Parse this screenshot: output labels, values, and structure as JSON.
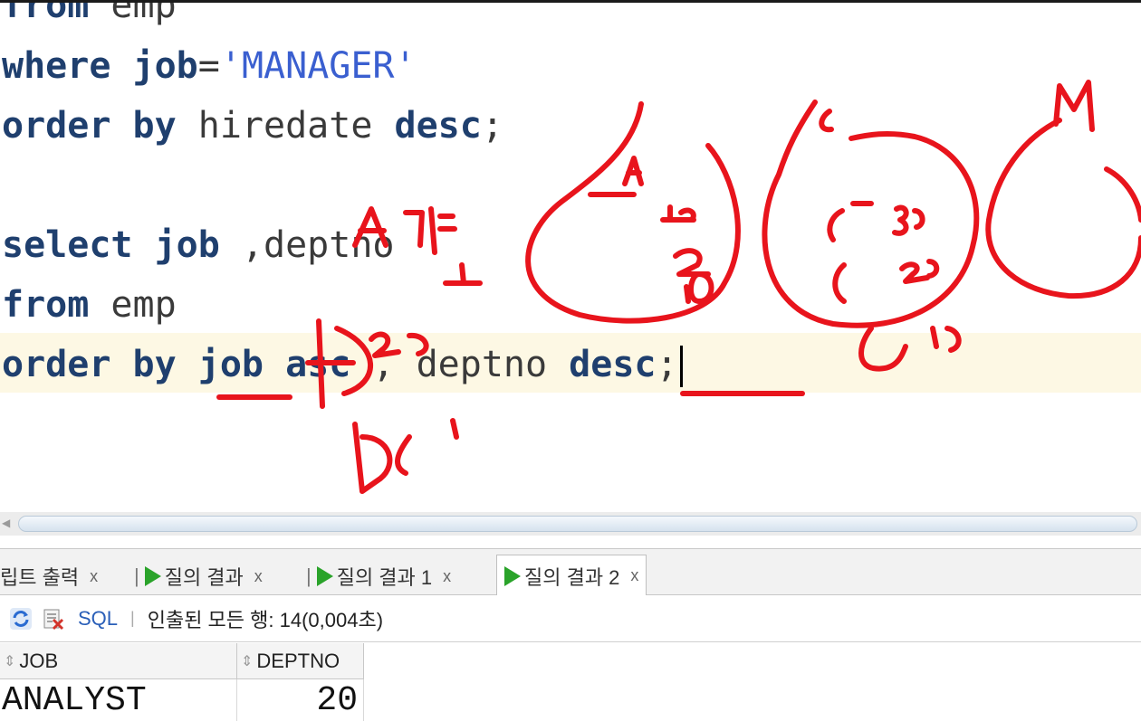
{
  "editor": {
    "lines": [
      {
        "id": "l1",
        "parts": [
          {
            "t": "from",
            "c": "kw"
          },
          {
            "t": " emp"
          }
        ]
      },
      {
        "id": "l2",
        "parts": [
          {
            "t": "where",
            "c": "kw"
          },
          {
            "t": " "
          },
          {
            "t": "job",
            "c": "kw"
          },
          {
            "t": "="
          },
          {
            "t": "'MANAGER'",
            "c": "str"
          }
        ]
      },
      {
        "id": "l3",
        "parts": [
          {
            "t": "order by",
            "c": "kw"
          },
          {
            "t": " hiredate "
          },
          {
            "t": "desc",
            "c": "kw"
          },
          {
            "t": ";"
          }
        ]
      },
      {
        "id": "l4",
        "parts": []
      },
      {
        "id": "l5",
        "parts": [
          {
            "t": "select",
            "c": "kw"
          },
          {
            "t": " "
          },
          {
            "t": "job",
            "c": "kw"
          },
          {
            "t": " ,deptno"
          }
        ]
      },
      {
        "id": "l6",
        "parts": [
          {
            "t": "from",
            "c": "kw"
          },
          {
            "t": " emp"
          }
        ]
      },
      {
        "id": "l7",
        "parts": [
          {
            "t": "order by",
            "c": "kw"
          },
          {
            "t": " "
          },
          {
            "t": "job",
            "c": "kw"
          },
          {
            "t": " "
          },
          {
            "t": "asc",
            "c": "kw"
          },
          {
            "t": " , deptno "
          },
          {
            "t": "desc",
            "c": "kw"
          },
          {
            "t": ";"
          }
        ]
      }
    ]
  },
  "annotations": {
    "ink_color": "#e8141c",
    "labels": [
      "A",
      "C",
      "M",
      "10",
      "20",
      "30",
      "20",
      "10",
      "20",
      "10"
    ]
  },
  "tabs": [
    {
      "label": "립트 출력",
      "close": "x",
      "icon": "none",
      "active": false
    },
    {
      "label": "질의 결과",
      "close": "x",
      "icon": "play",
      "active": false
    },
    {
      "label": "질의 결과 1",
      "close": "x",
      "icon": "play",
      "active": false
    },
    {
      "label": "질의 결과 2",
      "close": "x",
      "icon": "play",
      "active": true
    }
  ],
  "toolbar": {
    "refresh_icon": "refresh-icon",
    "clear_icon": "clear-icon",
    "sql_label": "SQL",
    "divider": "|",
    "status": "인출된 모든 행: 14(0,004초)"
  },
  "grid": {
    "columns": [
      {
        "label": "JOB"
      },
      {
        "label": "DEPTNO"
      }
    ],
    "rows": [
      {
        "job": "ANALYST",
        "deptno": "20"
      }
    ]
  },
  "colors": {
    "keyword": "#1f3f6e",
    "string": "#3a5fd0",
    "current_line": "#fdf8e4",
    "play_green": "#2aa32a"
  }
}
